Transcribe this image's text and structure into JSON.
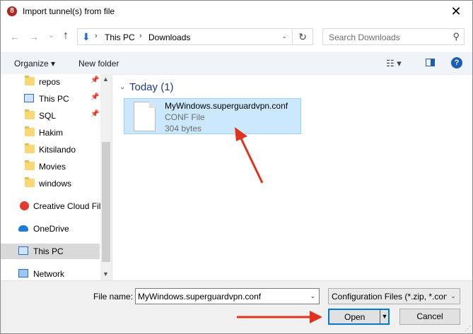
{
  "window": {
    "title": "Import tunnel(s) from file",
    "app_icon": "8",
    "close_glyph": "✕"
  },
  "nav": {
    "back_glyph": "←",
    "forward_glyph": "→",
    "recent_glyph": "⌄",
    "up_glyph": "↑",
    "breadcrumb": [
      "This PC",
      "Downloads"
    ],
    "chevron": "›",
    "dropdown_glyph": "⌄",
    "refresh_glyph": "↻",
    "search_placeholder": "Search Downloads",
    "search_glyph": "⚲"
  },
  "toolbar": {
    "organize": "Organize ▾",
    "new_folder": "New folder",
    "view_glyph": "☷ ▾",
    "help_glyph": "?"
  },
  "sidebar": {
    "pin_glyph": "📌",
    "items": [
      {
        "label": "repos",
        "icon": "folder-icon"
      },
      {
        "label": "This PC",
        "icon": "pc-icon"
      },
      {
        "label": "SQL",
        "icon": "folder-icon"
      },
      {
        "label": "Hakim",
        "icon": "folder-icon"
      },
      {
        "label": "Kitsilando",
        "icon": "folder-icon"
      },
      {
        "label": "Movies",
        "icon": "folder-icon"
      },
      {
        "label": "windows",
        "icon": "folder-icon"
      },
      {
        "label": "Creative Cloud Fil",
        "icon": "creative-cloud-icon"
      },
      {
        "label": "OneDrive",
        "icon": "onedrive-icon"
      },
      {
        "label": "This PC",
        "icon": "pc-icon"
      },
      {
        "label": "Network",
        "icon": "network-icon"
      }
    ],
    "scroll_up": "▲",
    "scroll_down": "▼"
  },
  "content": {
    "group_chevron": "⌄",
    "group_title": "Today (1)",
    "file": {
      "name": "MyWindows.superguardvpn.conf",
      "type": "CONF File",
      "size": "304 bytes"
    }
  },
  "bottom": {
    "file_name_label": "File name:",
    "file_name_value": "MyWindows.superguardvpn.conf",
    "file_name_dd": "⌄",
    "filter": "Configuration Files (*.zip, *.con",
    "filter_dd": "⌄",
    "open": "Open",
    "open_split": "▼",
    "cancel": "Cancel",
    "grip": "⋰"
  },
  "colors": {
    "annotation_arrow": "#e0321c",
    "selection": "#cce8ff",
    "accent": "#0078d7"
  }
}
